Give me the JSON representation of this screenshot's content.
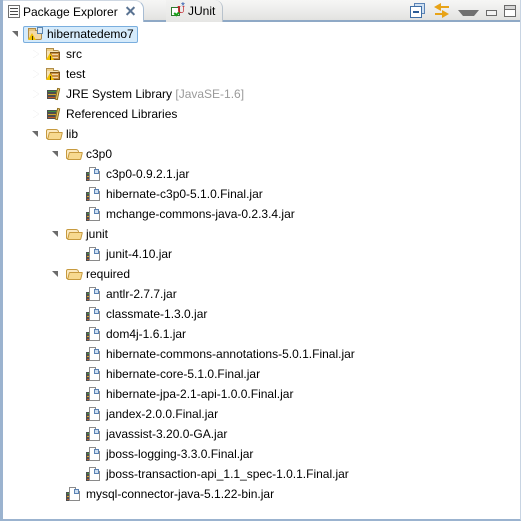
{
  "view": {
    "tabs": [
      {
        "label": "Package Explorer",
        "icon": "package-explorer-icon",
        "active": true,
        "closable": true
      },
      {
        "label": "JUnit",
        "icon": "junit-icon",
        "active": false,
        "closable": false
      }
    ],
    "toolbar": [
      {
        "name": "collapse-all-button",
        "tooltip": "Collapse All"
      },
      {
        "name": "link-with-editor-button",
        "tooltip": "Link with Editor"
      },
      {
        "name": "view-menu-button",
        "tooltip": "View Menu"
      },
      {
        "name": "minimize-button",
        "tooltip": "Minimize"
      },
      {
        "name": "maximize-button",
        "tooltip": "Maximize"
      }
    ]
  },
  "colors": {
    "selection_fill": "#d6ebfb",
    "selection_border": "#7aaede",
    "tab_underline": "#8fa9c6",
    "dim_text": "#9a9a9a",
    "frame": "#9bb3cf"
  },
  "tree": {
    "rows": [
      {
        "depth": 0,
        "twisty": "expanded",
        "icon": "java-project-icon",
        "label": "hibernatedemo7",
        "suffix": "",
        "selected": true
      },
      {
        "depth": 1,
        "twisty": "collapsed",
        "icon": "source-folder-icon",
        "label": "src",
        "suffix": "",
        "selected": false
      },
      {
        "depth": 1,
        "twisty": "collapsed",
        "icon": "source-folder-icon",
        "label": "test",
        "suffix": "",
        "selected": false
      },
      {
        "depth": 1,
        "twisty": "collapsed",
        "icon": "library-icon",
        "label": "JRE System Library ",
        "suffix": "[JavaSE-1.6]",
        "selected": false
      },
      {
        "depth": 1,
        "twisty": "collapsed",
        "icon": "library-icon",
        "label": "Referenced Libraries",
        "suffix": "",
        "selected": false
      },
      {
        "depth": 1,
        "twisty": "expanded",
        "icon": "folder-icon",
        "label": "lib",
        "suffix": "",
        "selected": false
      },
      {
        "depth": 2,
        "twisty": "expanded",
        "icon": "folder-icon",
        "label": "c3p0",
        "suffix": "",
        "selected": false
      },
      {
        "depth": 3,
        "twisty": "none",
        "icon": "jar-icon",
        "label": "c3p0-0.9.2.1.jar",
        "suffix": "",
        "selected": false
      },
      {
        "depth": 3,
        "twisty": "none",
        "icon": "jar-icon",
        "label": "hibernate-c3p0-5.1.0.Final.jar",
        "suffix": "",
        "selected": false
      },
      {
        "depth": 3,
        "twisty": "none",
        "icon": "jar-icon",
        "label": "mchange-commons-java-0.2.3.4.jar",
        "suffix": "",
        "selected": false
      },
      {
        "depth": 2,
        "twisty": "expanded",
        "icon": "folder-icon",
        "label": "junit",
        "suffix": "",
        "selected": false
      },
      {
        "depth": 3,
        "twisty": "none",
        "icon": "jar-icon",
        "label": "junit-4.10.jar",
        "suffix": "",
        "selected": false
      },
      {
        "depth": 2,
        "twisty": "expanded",
        "icon": "folder-icon",
        "label": "required",
        "suffix": "",
        "selected": false
      },
      {
        "depth": 3,
        "twisty": "none",
        "icon": "jar-icon",
        "label": "antlr-2.7.7.jar",
        "suffix": "",
        "selected": false
      },
      {
        "depth": 3,
        "twisty": "none",
        "icon": "jar-icon",
        "label": "classmate-1.3.0.jar",
        "suffix": "",
        "selected": false
      },
      {
        "depth": 3,
        "twisty": "none",
        "icon": "jar-icon",
        "label": "dom4j-1.6.1.jar",
        "suffix": "",
        "selected": false
      },
      {
        "depth": 3,
        "twisty": "none",
        "icon": "jar-icon",
        "label": "hibernate-commons-annotations-5.0.1.Final.jar",
        "suffix": "",
        "selected": false
      },
      {
        "depth": 3,
        "twisty": "none",
        "icon": "jar-icon",
        "label": "hibernate-core-5.1.0.Final.jar",
        "suffix": "",
        "selected": false
      },
      {
        "depth": 3,
        "twisty": "none",
        "icon": "jar-icon",
        "label": "hibernate-jpa-2.1-api-1.0.0.Final.jar",
        "suffix": "",
        "selected": false
      },
      {
        "depth": 3,
        "twisty": "none",
        "icon": "jar-icon",
        "label": "jandex-2.0.0.Final.jar",
        "suffix": "",
        "selected": false
      },
      {
        "depth": 3,
        "twisty": "none",
        "icon": "jar-icon",
        "label": "javassist-3.20.0-GA.jar",
        "suffix": "",
        "selected": false
      },
      {
        "depth": 3,
        "twisty": "none",
        "icon": "jar-icon",
        "label": "jboss-logging-3.3.0.Final.jar",
        "suffix": "",
        "selected": false
      },
      {
        "depth": 3,
        "twisty": "none",
        "icon": "jar-icon",
        "label": "jboss-transaction-api_1.1_spec-1.0.1.Final.jar",
        "suffix": "",
        "selected": false
      },
      {
        "depth": 2,
        "twisty": "none",
        "icon": "jar-icon",
        "label": "mysql-connector-java-5.1.22-bin.jar",
        "suffix": "",
        "selected": false
      }
    ]
  }
}
